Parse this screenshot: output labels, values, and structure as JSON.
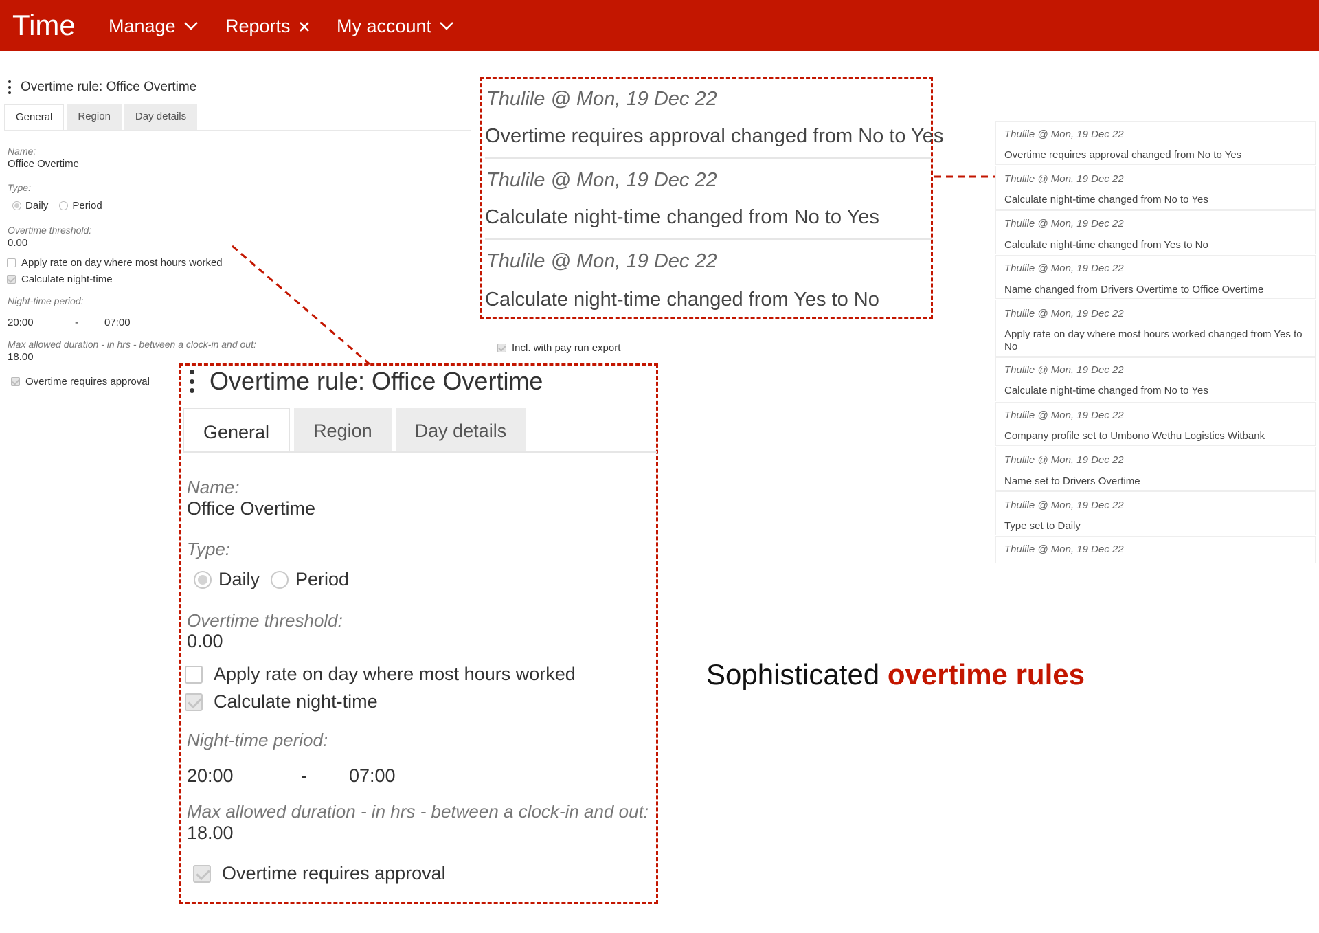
{
  "header": {
    "brand": "Time",
    "nav": [
      {
        "label": "Manage",
        "icon": "chevron-down-icon"
      },
      {
        "label": "Reports",
        "icon": "close-icon"
      },
      {
        "label": "My account",
        "icon": "chevron-down-icon"
      }
    ]
  },
  "form": {
    "title": "Overtime rule: Office Overtime",
    "tabs": [
      "General",
      "Region",
      "Day details"
    ],
    "name_label": "Name:",
    "name_value": "Office Overtime",
    "type_label": "Type:",
    "type_options": [
      "Daily",
      "Period"
    ],
    "type_selected": "Daily",
    "threshold_label": "Overtime threshold:",
    "threshold_value": "0.00",
    "apply_rate_label": "Apply rate on day where most hours worked",
    "apply_rate_checked": false,
    "night_time_label": "Calculate night-time",
    "night_time_checked": true,
    "night_period_label": "Night-time period:",
    "night_from": "20:00",
    "night_sep": "-",
    "night_to": "07:00",
    "max_duration_label": "Max allowed duration - in hrs - between a clock-in and out:",
    "max_duration_value": "18.00",
    "requires_approval_label": "Overtime requires approval",
    "requires_approval_checked": true,
    "payrun_label": "Incl. with pay run export",
    "payrun_checked": true
  },
  "history_zoom": [
    {
      "who": "Thulile @ Mon, 19 Dec 22",
      "msg": "Overtime requires approval changed from No to Yes"
    },
    {
      "who": "Thulile @ Mon, 19 Dec 22",
      "msg": "Calculate night-time changed from No to Yes"
    },
    {
      "who": "Thulile @ Mon, 19 Dec 22",
      "msg": "Calculate night-time changed from Yes to No"
    }
  ],
  "history": [
    {
      "who": "Thulile @ Mon, 19 Dec 22",
      "msg": "Overtime requires approval changed from No to Yes"
    },
    {
      "who": "Thulile @ Mon, 19 Dec 22",
      "msg": "Calculate night-time changed from No to Yes"
    },
    {
      "who": "Thulile @ Mon, 19 Dec 22",
      "msg": "Calculate night-time changed from Yes to No"
    },
    {
      "who": "Thulile @ Mon, 19 Dec 22",
      "msg": "Name changed from Drivers Overtime to Office Overtime"
    },
    {
      "who": "Thulile @ Mon, 19 Dec 22",
      "msg": "Apply rate on day where most hours worked changed from Yes to No"
    },
    {
      "who": "Thulile @ Mon, 19 Dec 22",
      "msg": "Calculate night-time changed from No to Yes"
    },
    {
      "who": "Thulile @ Mon, 19 Dec 22",
      "msg": "Company profile set to Umbono Wethu Logistics Witbank"
    },
    {
      "who": "Thulile @ Mon, 19 Dec 22",
      "msg": "Name set to Drivers Overtime"
    },
    {
      "who": "Thulile @ Mon, 19 Dec 22",
      "msg": "Type set to Daily"
    },
    {
      "who": "Thulile @ Mon, 19 Dec 22",
      "msg": ""
    }
  ],
  "tagline": {
    "prefix": "Sophisticated ",
    "highlight": "overtime rules"
  },
  "colors": {
    "brand": "#c31600",
    "annotation": "#c31600"
  }
}
